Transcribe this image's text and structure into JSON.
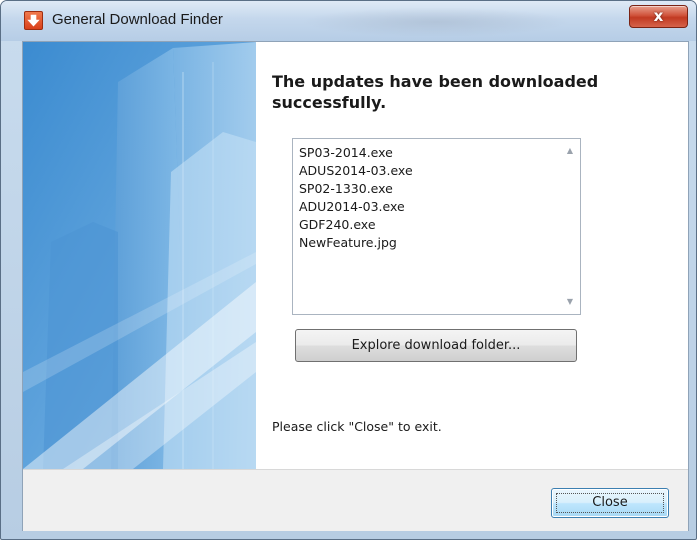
{
  "window": {
    "title": "General Download Finder",
    "close_glyph": "x"
  },
  "main": {
    "heading": "The updates have been downloaded successfully.",
    "files": [
      "SP03-2014.exe",
      "ADUS2014-03.exe",
      "SP02-1330.exe",
      "ADU2014-03.exe",
      "GDF240.exe",
      "NewFeature.jpg"
    ],
    "explore_button": "Explore download folder...",
    "instruction": "Please click \"Close\" to exit."
  },
  "footer": {
    "close_button": "Close"
  },
  "icons": {
    "app": "download-arrow-icon",
    "scroll_up": "scroll-up-arrow-icon",
    "scroll_down": "scroll-down-arrow-icon"
  },
  "colors": {
    "side_panel_blue": "#4a90cc",
    "close_x_red": "#c94a33",
    "default_button_border": "#3c7fb1"
  }
}
